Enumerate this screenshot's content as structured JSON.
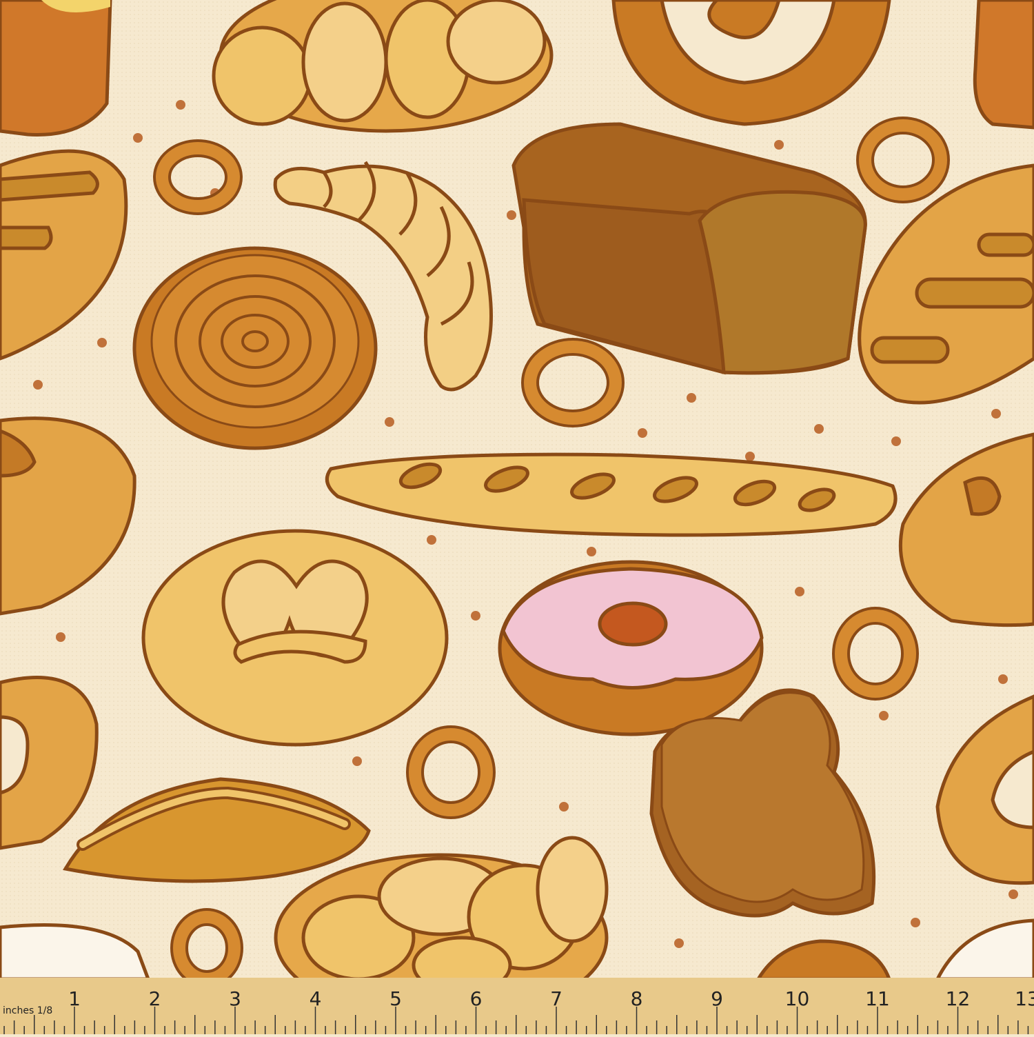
{
  "background_color": "#f6e9cf",
  "outline_color": "#8a4a16",
  "crust_color": "#c97a24",
  "dough_color": "#f0c46a",
  "glaze_color": "#f2c4d2",
  "ruler": {
    "color": "#e8c98a",
    "unit_label": "inches 1/8",
    "numbers": [
      "1",
      "2",
      "3",
      "4",
      "5",
      "6",
      "7",
      "8",
      "9",
      "10",
      "11",
      "12",
      "13"
    ]
  }
}
